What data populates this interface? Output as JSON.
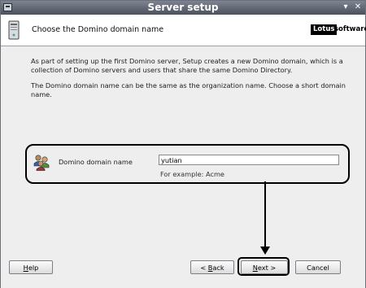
{
  "window": {
    "title": "Server setup",
    "minimize_glyph": "▾",
    "close_glyph": "✕"
  },
  "header": {
    "step_title": "Choose the Domino domain name",
    "logo_box": "Lotus",
    "logo_text": "software"
  },
  "body": {
    "paragraph1": "As part of setting up the first Domino server, Setup creates a new Domino domain, which is a collection of Domino servers and users that share the same Domino Directory.",
    "paragraph2": "The Domino domain name can be the same as the organization name. Choose a short domain name."
  },
  "field": {
    "label": "Domino domain name",
    "value": "yutian",
    "example": "For example: Acme",
    "icon": "users-icon"
  },
  "buttons": {
    "help": {
      "pre": "",
      "key": "H",
      "post": "elp"
    },
    "back": {
      "pre": "< ",
      "key": "B",
      "post": "ack"
    },
    "next": {
      "pre": "",
      "key": "N",
      "post": "ext >"
    },
    "cancel": {
      "pre": "Cancel",
      "key": "",
      "post": ""
    }
  }
}
